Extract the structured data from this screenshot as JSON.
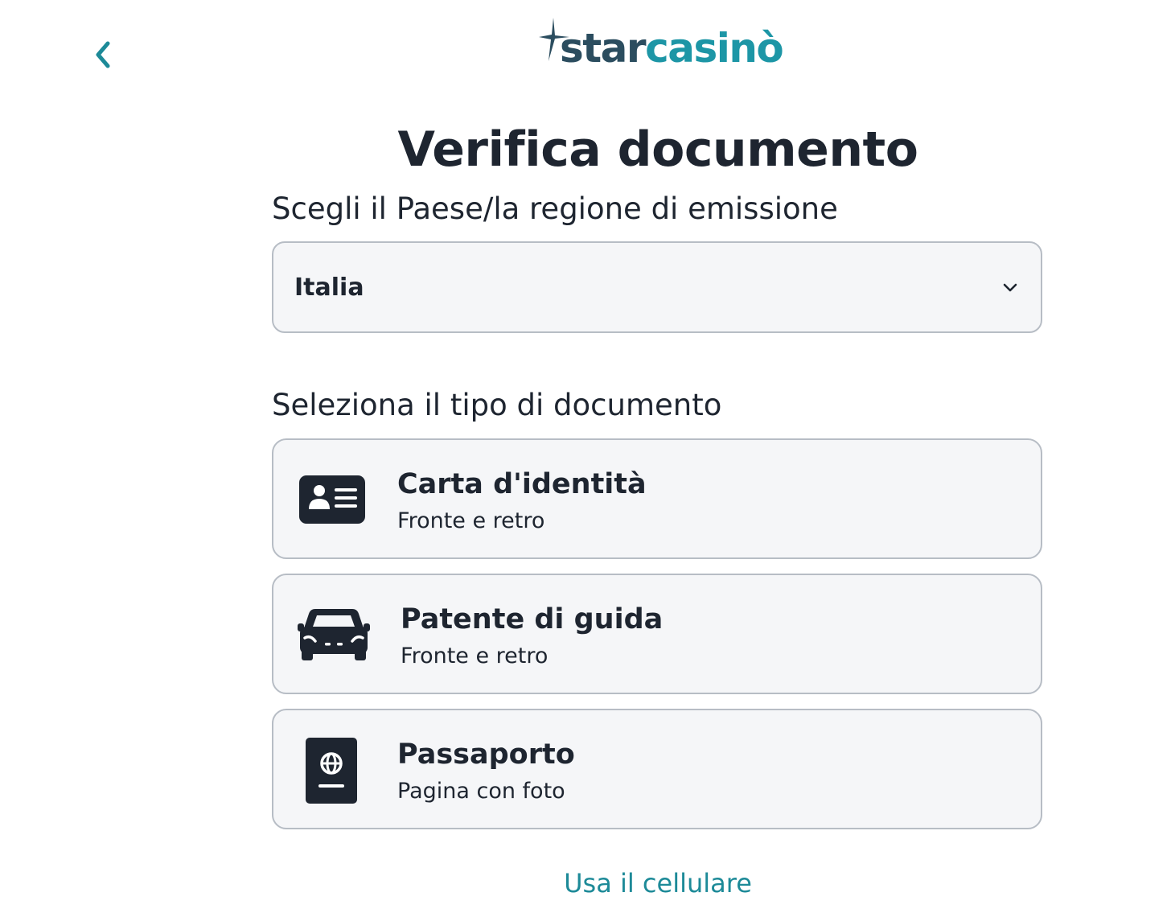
{
  "header": {
    "back_icon": "chevron-left-icon",
    "logo": {
      "part1": "star",
      "part2": "casinò",
      "brand_dark": "#2b4d5f",
      "brand_teal": "#1d96a6"
    }
  },
  "title": "Verifica documento",
  "country": {
    "label": "Scegli il Paese/la regione di emissione",
    "selected": "Italia",
    "icon": "chevron-down-icon"
  },
  "documents": {
    "label": "Seleziona il tipo di documento",
    "options": [
      {
        "title": "Carta d'identità",
        "subtitle": "Fronte e retro",
        "icon": "id-card-icon"
      },
      {
        "title": "Patente di guida",
        "subtitle": "Fronte e retro",
        "icon": "car-icon"
      },
      {
        "title": "Passaporto",
        "subtitle": "Pagina con foto",
        "icon": "passport-icon"
      }
    ]
  },
  "footer": {
    "link": "Usa il cellulare",
    "link_color": "#1d8a98"
  }
}
